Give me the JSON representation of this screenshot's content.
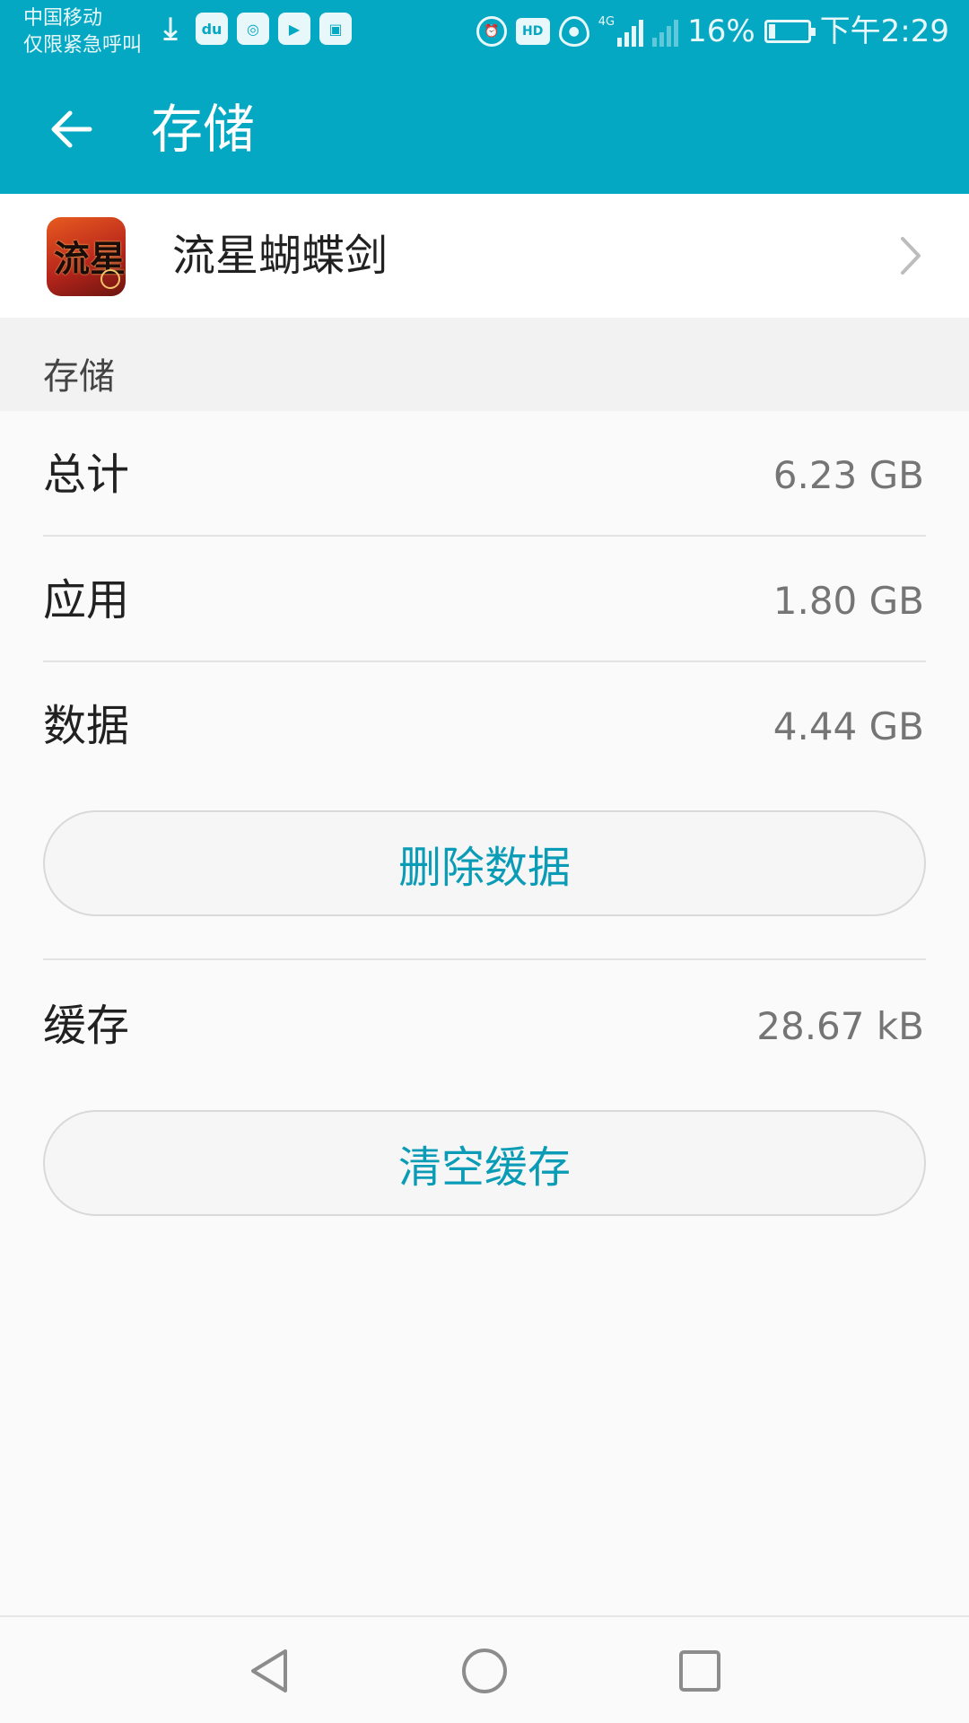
{
  "status_bar": {
    "carrier": "中国移动",
    "emergency": "仅限紧急呼叫",
    "network": "4G",
    "hd_label": "HD",
    "battery_percent": "16%",
    "battery_level": 0.16,
    "time": "下午2:29",
    "notification_icons": [
      "download-icon",
      "du-map-icon",
      "photo-app-icon",
      "video-app-icon",
      "vmall-icon"
    ],
    "status_icons": [
      "alarm-icon",
      "hd-icon",
      "eye-comfort-icon",
      "signal-icon",
      "no-sim-signal-icon",
      "battery-icon"
    ]
  },
  "app_bar": {
    "title": "存储",
    "back_icon": "arrow-left-icon",
    "background_color": "#04a8c3"
  },
  "app_info": {
    "name": "流星蝴蝶剑",
    "icon_glyph": "流星"
  },
  "storage": {
    "section_title": "存储",
    "rows": [
      {
        "label": "总计",
        "value": "6.23 GB"
      },
      {
        "label": "应用",
        "value": "1.80 GB"
      },
      {
        "label": "数据",
        "value": "4.44 GB"
      }
    ],
    "delete_data_label": "删除数据",
    "cache_label": "缓存",
    "cache_value": "28.67 kB",
    "clear_cache_label": "清空缓存",
    "accent_color": "#0a9cb6"
  },
  "nav_bar": {
    "buttons": [
      "back-triangle-icon",
      "home-circle-icon",
      "recents-square-icon"
    ]
  }
}
